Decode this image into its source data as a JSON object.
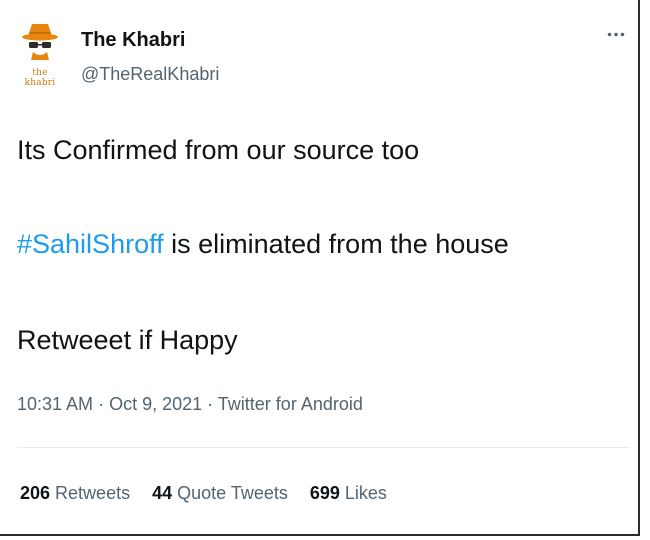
{
  "tweet": {
    "author": {
      "name": "The Khabri",
      "handle": "@TheRealKhabri",
      "avatar_text": "the khabri"
    },
    "text": {
      "line1": "Its Confirmed from our source too",
      "hashtag": "#SahilShroff",
      "line2_rest": " is eliminated from the house",
      "line3": "Retweeet if Happy"
    },
    "meta": {
      "time": "10:31 AM",
      "sep1": " · ",
      "date": "Oct 9, 2021",
      "sep2": " · ",
      "source": "Twitter for Android"
    },
    "stats": {
      "retweets": "206",
      "retweets_label": " Retweets",
      "quotes": "44",
      "quotes_label": " Quote Tweets",
      "likes": "699",
      "likes_label": " Likes"
    }
  },
  "icons": {
    "avatar": "detective-hat-glasses",
    "more": "more-horizontal-icon"
  },
  "colors": {
    "link": "#1d9bf0",
    "text": "#0f1419",
    "secondary": "#536471",
    "avatar_accent": "#e8860f"
  }
}
